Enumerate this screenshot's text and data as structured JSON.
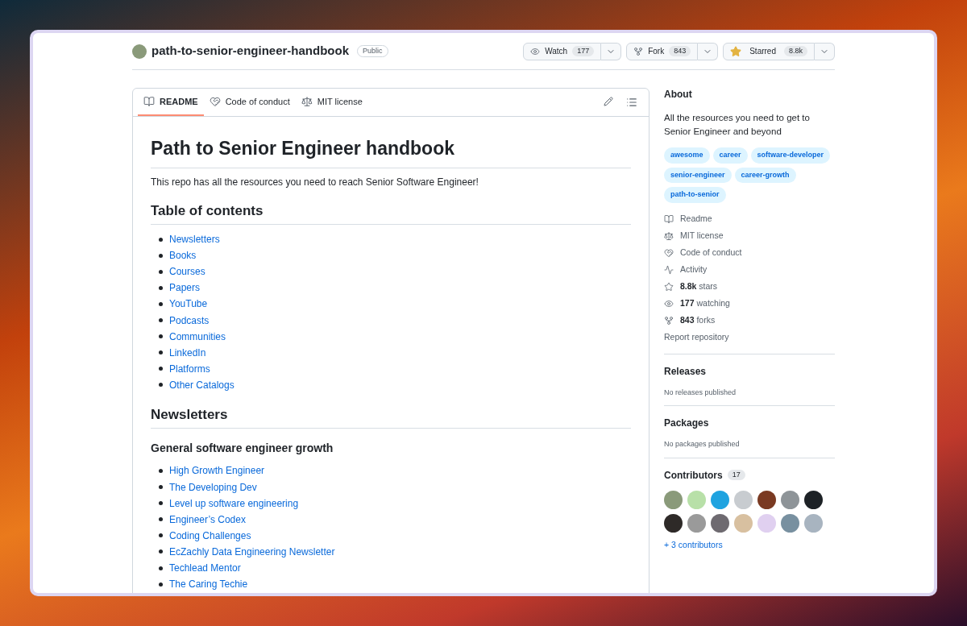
{
  "repo": {
    "name": "path-to-senior-engineer-handbook",
    "visibility": "Public"
  },
  "actions": [
    {
      "kind": "watch",
      "label": "Watch",
      "count": "177"
    },
    {
      "kind": "fork",
      "label": "Fork",
      "count": "843"
    },
    {
      "kind": "star",
      "label": "Starred",
      "count": "8.8k"
    }
  ],
  "tabs": [
    {
      "kind": "book",
      "label": "README",
      "selected": true
    },
    {
      "kind": "heart",
      "label": "Code of conduct",
      "selected": false
    },
    {
      "kind": "scale",
      "label": "MIT license",
      "selected": false
    }
  ],
  "readme": {
    "title": "Path to Senior Engineer handbook",
    "intro": "This repo has all the resources you need to reach Senior Software Engineer!",
    "toc_heading": "Table of contents",
    "toc": [
      "Newsletters",
      "Books",
      "Courses",
      "Papers",
      "YouTube",
      "Podcasts",
      "Communities",
      "LinkedIn",
      "Platforms",
      "Other Catalogs"
    ],
    "section_heading": "Newsletters",
    "subsection_heading": "General software engineer growth",
    "links": [
      "High Growth Engineer",
      "The Developing Dev",
      "Level up software engineering",
      "Engineer’s Codex",
      "Coding Challenges",
      "EcZachly Data Engineering Newsletter",
      "Techlead Mentor",
      "The Caring Techie"
    ]
  },
  "about": {
    "heading": "About",
    "description": "All the resources you need to get to Senior Engineer and beyond",
    "topics": [
      "awesome",
      "career",
      "software-developer",
      "senior-engineer",
      "career-growth",
      "path-to-senior"
    ],
    "meta": [
      {
        "kind": "book",
        "text": "Readme"
      },
      {
        "kind": "scale",
        "text": "MIT license"
      },
      {
        "kind": "heart",
        "text": "Code of conduct"
      },
      {
        "kind": "pulse",
        "text": "Activity"
      },
      {
        "kind": "star",
        "strong": "8.8k",
        "text": "stars"
      },
      {
        "kind": "eye",
        "strong": "177",
        "text": "watching"
      },
      {
        "kind": "fork",
        "strong": "843",
        "text": "forks"
      }
    ],
    "report": "Report repository"
  },
  "releases": {
    "heading": "Releases",
    "note": "No releases published"
  },
  "packages": {
    "heading": "Packages",
    "note": "No packages published"
  },
  "contributors": {
    "heading": "Contributors",
    "count": "17",
    "more": "+ 3 contributors"
  }
}
